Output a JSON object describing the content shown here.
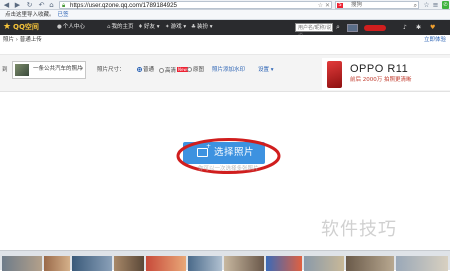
{
  "browser": {
    "url": "https://user.qzone.qq.com/1789184925",
    "search_placeholder": "搜狗",
    "search_engine": "S",
    "bookmark_text": "点击这里导入收藏。",
    "bookmark_link": "已签",
    "icons": [
      "back-icon",
      "forward-icon",
      "refresh-icon",
      "home-icon",
      "lock-icon",
      "star-icon",
      "search-icon",
      "wechat-icon"
    ]
  },
  "qzone_bar": {
    "logo": "QQ空间",
    "nav": [
      "个人中心",
      "我的主页",
      "好友",
      "游戏",
      "装扮"
    ],
    "search_placeholder": "用户名/昵称/说说",
    "right_icons": [
      "bell-icon",
      "gear-icon",
      "heart-icon"
    ]
  },
  "breadcrumb": {
    "path": "照片 › 普通上传",
    "right_link": "立即体验"
  },
  "upload_options": {
    "upload_to_label": "到",
    "album_name": "一条公共汽车的照片",
    "photo_size_label": "照片尺寸：",
    "sizes": [
      {
        "label": "普通",
        "selected": true
      },
      {
        "label": "高清",
        "selected": false,
        "badge": "New"
      },
      {
        "label": "原图",
        "selected": false
      }
    ],
    "watermark_label": "照片添加水印",
    "settings_label": "设置 ▾"
  },
  "ad": {
    "title": "OPPO R11",
    "subtitle": "前后 2000万 拍照更清晰"
  },
  "main": {
    "select_button": "选择照片",
    "hint": "你可以一次选择多张照片",
    "site_watermark": "软件技巧"
  },
  "colors": {
    "qzone_bar": "#2a2b2e",
    "select_button": "#3d92e0",
    "annotation_ellipse": "#d01e1e",
    "link": "#2a62b4"
  }
}
